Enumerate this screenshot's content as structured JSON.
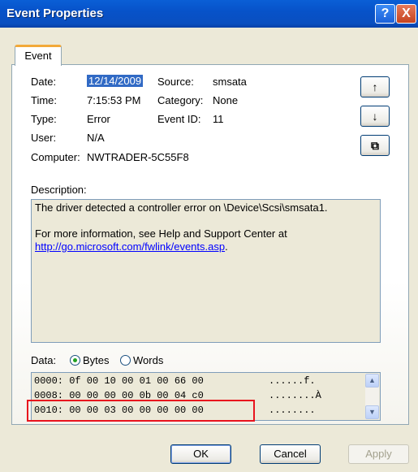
{
  "window": {
    "title": "Event Properties",
    "help": "?",
    "close": "X"
  },
  "tab": "Event",
  "fields": {
    "date_label": "Date:",
    "date_value": "12/14/2009",
    "source_label": "Source:",
    "source_value": "smsata",
    "time_label": "Time:",
    "time_value": "7:15:53 PM",
    "category_label": "Category:",
    "category_value": "None",
    "type_label": "Type:",
    "type_value": "Error",
    "eventid_label": "Event ID:",
    "eventid_value": "11",
    "user_label": "User:",
    "user_value": "N/A",
    "computer_label": "Computer:",
    "computer_value": "NWTRADER-5C55F8"
  },
  "side_buttons": {
    "up": "↑",
    "down": "↓",
    "copy": "⧉"
  },
  "description": {
    "label": "Description:",
    "line1": "The driver detected a controller error on \\Device\\Scsi\\smsata1.",
    "line2": "For more information, see Help and Support Center at",
    "link": "http://go.microsoft.com/fwlink/events.asp",
    "link_suffix": "."
  },
  "data": {
    "label": "Data:",
    "bytes_label": "Bytes",
    "words_label": "Words",
    "selected": "Bytes",
    "rows": [
      {
        "hex": "0000: 0f 00 10 00 01 00 66 00",
        "ascii": "......f."
      },
      {
        "hex": "0008: 00 00 00 00 0b 00 04 c0",
        "ascii": "........À"
      },
      {
        "hex": "0010: 00 00 03 00 00 00 00 00",
        "ascii": "........"
      }
    ]
  },
  "buttons": {
    "ok": "OK",
    "cancel": "Cancel",
    "apply": "Apply"
  }
}
